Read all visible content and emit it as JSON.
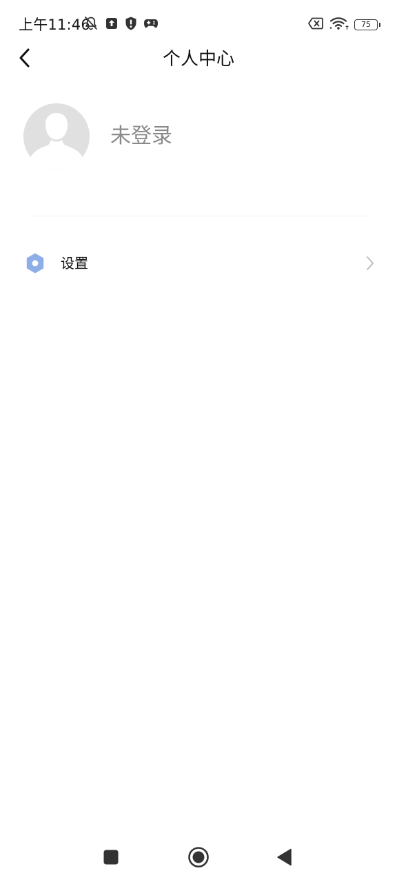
{
  "status_bar": {
    "time": "上午11:46",
    "battery_level": "75",
    "left_icons": [
      "bell-off-icon",
      "upload-icon",
      "shield-alert-icon",
      "gamepad-icon"
    ],
    "right_icons": [
      "sim-error-icon",
      "wifi-icon",
      "battery-icon"
    ]
  },
  "header": {
    "title": "个人中心",
    "back_icon": "chevron-left-icon"
  },
  "profile": {
    "login_status": "未登录",
    "avatar_icon": "person-silhouette"
  },
  "menu": {
    "items": [
      {
        "label": "设置",
        "icon": "settings-hexagon-icon",
        "icon_color": "#8eaee8"
      }
    ]
  },
  "system_nav": {
    "buttons": [
      "recents",
      "home",
      "back"
    ]
  },
  "colors": {
    "background": "#ffffff",
    "avatar_background": "#e0e0e0",
    "muted_text": "#8a8a8a",
    "accent": "#8eaee8"
  }
}
